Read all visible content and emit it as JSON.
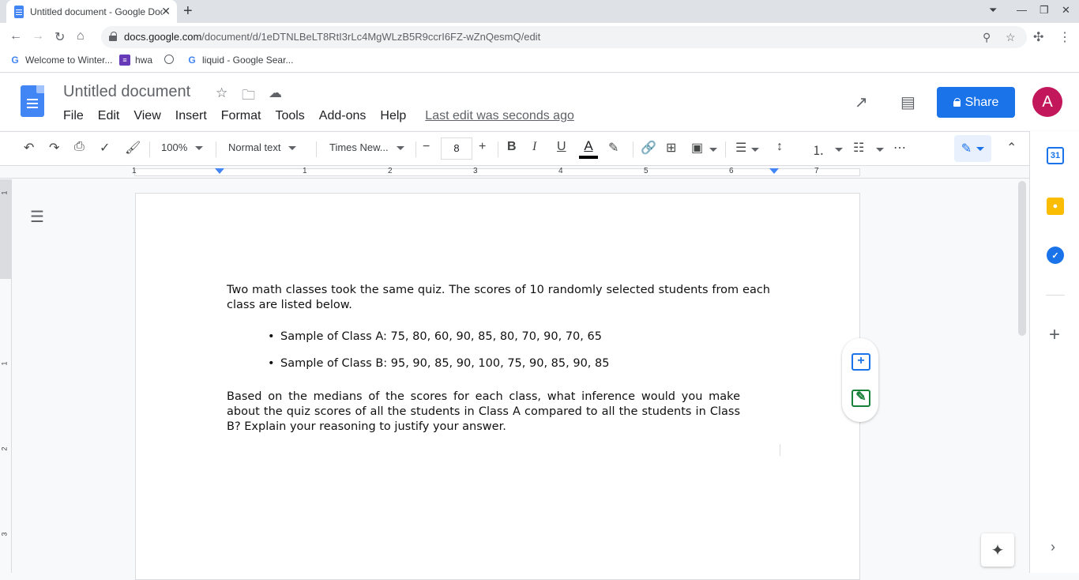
{
  "browser": {
    "tab_title": "Untitled document - Google Doc",
    "tab_close": "✕",
    "new_tab": "+",
    "url_host": "docs.google.com",
    "url_path": "/document/d/1eDTNLBeLT8RtI3rLc4MgWLzB5R9ccrI6FZ-wZnQesmQ/edit",
    "bookmarks": [
      {
        "label": "Welcome to Winter...",
        "icon": "google-icon"
      },
      {
        "label": "hwa",
        "icon": "list-icon"
      },
      {
        "label": "",
        "icon": "globe-icon"
      },
      {
        "label": "liquid - Google Sear...",
        "icon": "google-icon"
      }
    ]
  },
  "docs": {
    "title": "Untitled document",
    "menu": [
      "File",
      "Edit",
      "View",
      "Insert",
      "Format",
      "Tools",
      "Add-ons",
      "Help"
    ],
    "last_edit": "Last edit was seconds ago",
    "share_label": "Share",
    "avatar_initial": "A"
  },
  "toolbar": {
    "zoom": "100%",
    "style": "Normal text",
    "font": "Times New...",
    "font_size": "8"
  },
  "ruler": {
    "labels": [
      "1",
      "1",
      "2",
      "3",
      "4",
      "5",
      "6",
      "7"
    ],
    "vertical_labels": [
      "1",
      "1",
      "2",
      "3"
    ]
  },
  "document": {
    "intro": "Two math classes took the same quiz. The scores of 10 randomly selected students from each class are listed below.",
    "bullets": [
      "Sample of Class A: 75, 80, 60, 90, 85, 80, 70, 90, 70, 65",
      "Sample of Class B: 95, 90, 85, 90, 100, 75, 90, 85, 90, 85"
    ],
    "question": "Based on the medians of the scores for each class, what inference would you make about the quiz scores of all the students in Class A compared to all the students in Class B? Explain your reasoning to justify your answer."
  },
  "side_apps": {
    "calendar_day": "31"
  },
  "colors": {
    "accent": "#1a73e8",
    "docs_blue": "#4285f4",
    "avatar": "#c2185b",
    "keep_yellow": "#fbbc04",
    "comment_blue": "#1a73e8",
    "suggest_green": "#188038"
  }
}
